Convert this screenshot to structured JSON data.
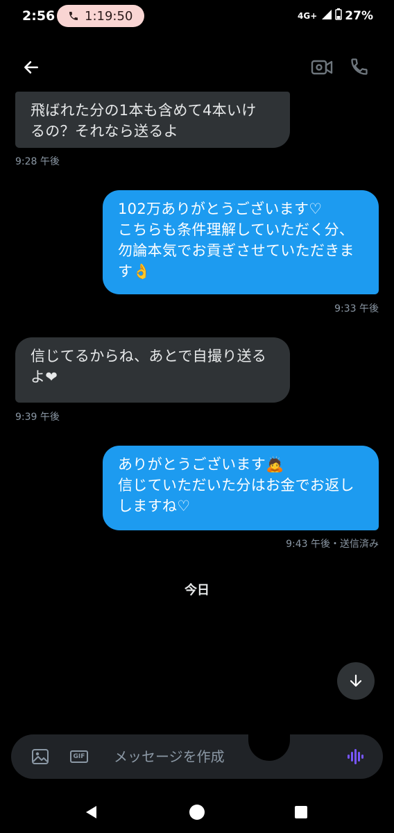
{
  "status": {
    "time": "2:56",
    "call_timer": "1:19:50",
    "network": "4G+",
    "battery": "27%"
  },
  "header": {
    "back_icon": "arrow-left-icon",
    "video_icon": "video-camera-icon",
    "call_icon": "phone-icon"
  },
  "messages": [
    {
      "direction": "received",
      "lines": [
        "飛ばれた分の1本も含めて4本いけ",
        "るの？それなら送るよ"
      ],
      "time": "9:28 午後"
    },
    {
      "direction": "sent",
      "lines": [
        "102万ありがとうございます♡",
        "こちらも条件理解していただく分、",
        "勿論本気でお貢ぎさせていただきま",
        "す👌"
      ],
      "time": "9:33 午後"
    },
    {
      "direction": "received",
      "lines": [
        "信じてるからね、あとで自撮り送る",
        "よ❤"
      ],
      "time": "9:39 午後"
    },
    {
      "direction": "sent",
      "lines": [
        "ありがとうございます🙇",
        "信じていただいた分はお金でお返し",
        "しますね♡"
      ],
      "time": "9:43 午後・送信済み"
    }
  ],
  "day_separator": "今日",
  "composer": {
    "placeholder": "メッセージを作成",
    "gif_label": "GIF"
  },
  "colors": {
    "sent_bubble": "#1d9bf0",
    "received_bubble": "#2f3336",
    "voice_accent": "#7856ff"
  }
}
